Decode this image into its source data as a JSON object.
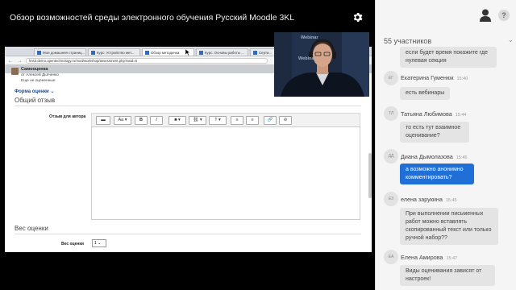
{
  "window": {
    "title": "Обзор возможностей среды электронного обучения Русский Moodle 3KL"
  },
  "icons": {
    "settings": "gear-icon",
    "user": "user-icon",
    "help": "help-icon"
  },
  "browser": {
    "tabs": [
      {
        "label": "Моя домашняя страниц..."
      },
      {
        "label": "Курс: Устройство мет..."
      },
      {
        "label": "Обзор методичка"
      },
      {
        "label": "Курс: Основы работы ..."
      },
      {
        "label": "Серти..."
      }
    ],
    "url": "lms3.demo.opentechnology.ru/mod/workshop/assessment.php?asid=6"
  },
  "assessment": {
    "title": "Самооценка",
    "from": "от Алексей Дьяченко",
    "status": "Еще не оцененные",
    "form_heading": "Форма оценки",
    "section_general": "Общий отзыв",
    "feedback_label": "Отзыв для автора",
    "section_weight": "Вес оценки",
    "weight_label": "Вес оценки",
    "weight_value": "1"
  },
  "editor_toolbar": [
    "▬",
    "Aa ▾",
    "B",
    "I",
    "■ ▾",
    "⛓ ▾",
    "T ▾",
    "≡",
    "≡",
    "🔗",
    "⊘"
  ],
  "webcam": {
    "watermark_1": "Webinar",
    "watermark_2": "Webinar"
  },
  "chat": {
    "participants": "55 участников",
    "messages": [
      {
        "initials": "",
        "name": "",
        "time": "",
        "text": "если будет время покажите где нулевая секция",
        "self": false
      },
      {
        "initials": "ЕГ",
        "name": "Екатерина Гуменюк",
        "time": "15:40",
        "text": "есть вебинары",
        "self": false
      },
      {
        "initials": "ТЛ",
        "name": "Татьяна Любимова",
        "time": "15:44",
        "text": "то есть тут взаимное оценивание?",
        "self": false
      },
      {
        "initials": "ДД",
        "name": "Диана Дымолазова",
        "time": "15:45",
        "text": "а возможно анонимно комментировать?",
        "self": true
      },
      {
        "initials": "ЕЗ",
        "name": "елена зарукина",
        "time": "15:45",
        "text": "При выполнении письменных работ можно вставлять скопированный текст или только ручной набор??",
        "self": false
      },
      {
        "initials": "ЕА",
        "name": "Елена Амирова",
        "time": "15:47",
        "text": "Виды оценивания зависят от настроек!",
        "self": false
      }
    ]
  }
}
